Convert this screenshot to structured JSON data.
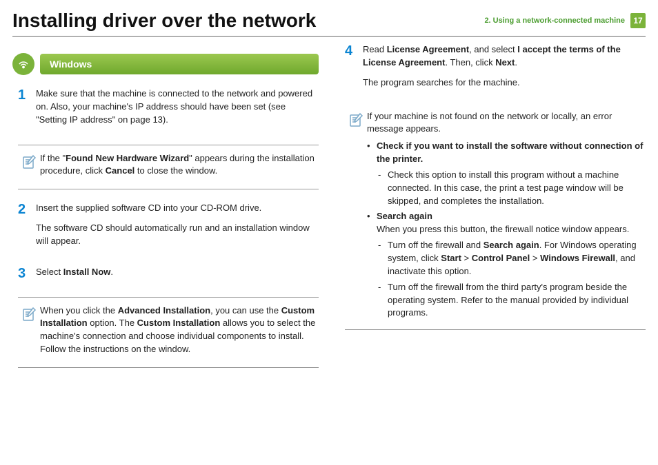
{
  "header": {
    "title": "Installing driver over the network",
    "chapter": "2.  Using a network-connected machine",
    "page": "17"
  },
  "section": {
    "label": "Windows"
  },
  "left": {
    "step1": "Make sure that the machine is connected to the network and powered on. Also, your machine's IP address should have been set (see \"Setting IP address\" on page 13).",
    "note1a": "If the \"",
    "note1b": "Found New Hardware Wizard",
    "note1c": "\" appears during the installation procedure, click ",
    "note1d": "Cancel",
    "note1e": " to close the window.",
    "step2a": "Insert the supplied software CD into your CD-ROM drive.",
    "step2b": "The software CD should automatically run and an installation window will appear.",
    "step3a": "Select ",
    "step3b": "Install Now",
    "step3c": ".",
    "note2a": "When you click the ",
    "note2b": "Advanced Installation",
    "note2c": ", you can use the ",
    "note2d": "Custom Installation",
    "note2e": " option. The ",
    "note2f": "Custom Installation",
    "note2g": " allows you to select the machine's connection and choose individual components to install. Follow the instructions on the window."
  },
  "right": {
    "step4a": "Read ",
    "step4b": "License Agreement",
    "step4c": ", and select ",
    "step4d": "I accept the terms of the License Agreement",
    "step4e": ". Then, click ",
    "step4f": "Next",
    "step4g": ".",
    "step4p": "The program searches for the machine.",
    "noteA": "If your machine is not found on the network or locally, an error message appears.",
    "b1": "Check if you want to install the software without connection of the printer.",
    "b1s": "Check this option to install this program without a machine connected. In this case, the print a test page window will be skipped, and completes the installation.",
    "b2": "Search again",
    "b2a": "When you press this button, the firewall notice window appears.",
    "b2s1a": "Turn off the firewall and ",
    "b2s1b": "Search again",
    "b2s1c": ". For Windows operating system, click ",
    "b2s1d": "Start",
    "b2s1e": " > ",
    "b2s1f": "Control Panel",
    "b2s1g": " > ",
    "b2s1h": "Windows Firewall",
    "b2s1i": ", and inactivate this option.",
    "b2s2": "Turn off the firewall from the third party's program beside the operating system. Refer to the manual provided by individual programs."
  }
}
